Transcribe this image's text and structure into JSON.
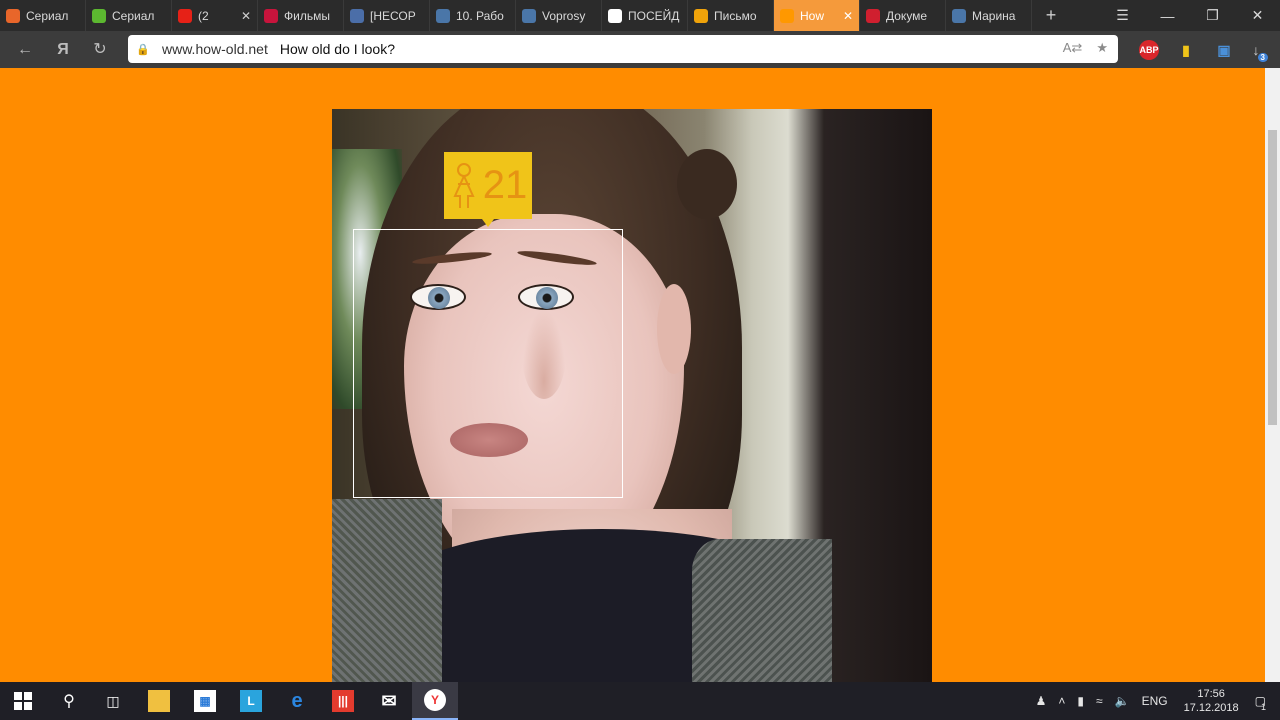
{
  "browser": {
    "tabs": [
      {
        "label": "Сериал",
        "icon": "flame-icon",
        "color": "#e8662a",
        "active": false
      },
      {
        "label": "Сериал",
        "icon": "hd-icon",
        "color": "#5cb830",
        "active": false
      },
      {
        "label": "(2",
        "icon": "youtube-icon",
        "color": "#e62117",
        "active": false
      },
      {
        "label": "Фильмы",
        "icon": "eye-icon",
        "color": "#c8143c",
        "active": false
      },
      {
        "label": "[НЕСОР",
        "icon": "s-icon",
        "color": "#4b6ea8",
        "active": false
      },
      {
        "label": "10. Рабо",
        "icon": "vk-icon",
        "color": "#4a76a8",
        "active": false
      },
      {
        "label": "Voprosy",
        "icon": "vk-icon",
        "color": "#4a76a8",
        "active": false
      },
      {
        "label": "ПОСЕЙД",
        "icon": "x-circle-icon",
        "color": "#ffffff",
        "active": false
      },
      {
        "label": "Письмо",
        "icon": "mail-icon",
        "color": "#f0a30a",
        "active": false
      },
      {
        "label": "How",
        "icon": "face-icon",
        "color": "#ff9800",
        "active": true
      },
      {
        "label": "Докуме",
        "icon": "doc-icon",
        "color": "#d01f2f",
        "active": false
      },
      {
        "label": "Марина",
        "icon": "vk-icon",
        "color": "#4a76a8",
        "active": false
      }
    ],
    "address": {
      "url": "www.how-old.net",
      "page_title": "How old do I look?"
    },
    "extensions": {
      "adblock_label": "ABP",
      "downloads_count": "3"
    }
  },
  "result": {
    "age": "21",
    "gender_icon": "female-icon",
    "tag_color": "#f0c419",
    "age_color": "#e69313"
  },
  "page": {
    "background": "#ff8c00"
  },
  "taskbar": {
    "lang": "ENG",
    "time": "17:56",
    "date": "17.12.2018",
    "notification_count": "1"
  }
}
